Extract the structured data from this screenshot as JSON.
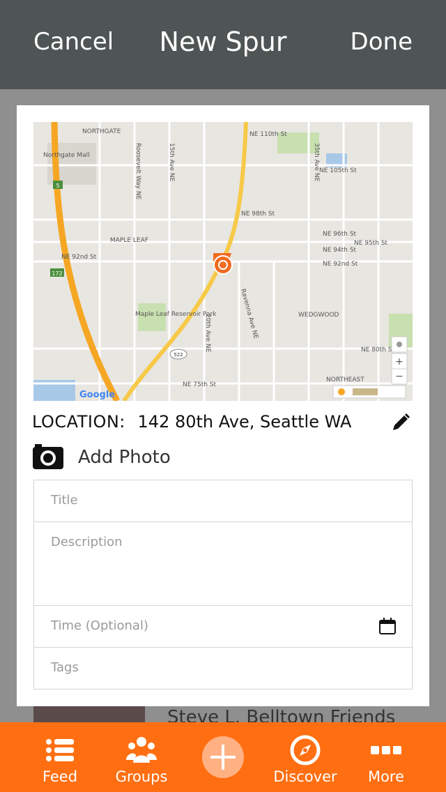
{
  "nav": {
    "cancel_label": "Cancel",
    "title": "New Spur",
    "done_label": "Done"
  },
  "map": {
    "attribution": "Google",
    "street_labels": [
      "NORTHGATE",
      "NE 110th St",
      "Northgate Mall",
      "NE 105th St",
      "NE 98th St",
      "NE 95th St",
      "NE 96th St",
      "NE 94th St",
      "NE 92nd St",
      "NE 92nd St",
      "NE 80th St",
      "NE 75th St",
      "MAPLE LEAF",
      "Maple Leaf Reservoir Park",
      "WEDGWOOD",
      "NORTHEAST",
      "Roosevelt Way NE",
      "15th Ave NE",
      "35th Ave NE",
      "20th Ave NE",
      "Ravenna Ave NE",
      "5",
      "172",
      "522"
    ],
    "pin_color": "#f26b21",
    "highway_color": "#f5a623"
  },
  "location": {
    "label": "LOCATION:",
    "value": "142 80th Ave, Seattle WA",
    "edit_icon": "pencil-icon"
  },
  "add_photo": {
    "label": "Add Photo",
    "icon": "camera-icon"
  },
  "form": {
    "title_placeholder": "Title",
    "description_placeholder": "Description",
    "time_placeholder": "Time (Optional)",
    "tags_placeholder": "Tags"
  },
  "background_item": {
    "text": "Steve L. Belltown Friends"
  },
  "tabbar": {
    "feed": "Feed",
    "groups": "Groups",
    "discover": "Discover",
    "more": "More",
    "accent": "#ff6f12"
  }
}
